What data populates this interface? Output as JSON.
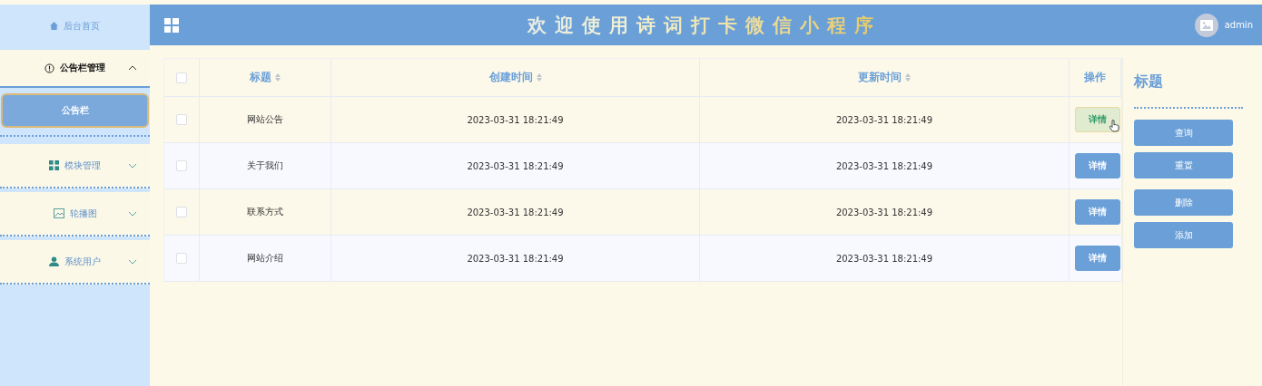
{
  "sidebar": {
    "home": {
      "label": "后台首页"
    },
    "menus": [
      {
        "label": "公告栏管理",
        "kind": "info",
        "expanded": true,
        "children": [
          {
            "label": "公告栏",
            "selected": true
          }
        ]
      },
      {
        "label": "模块管理",
        "kind": "grid",
        "expanded": false
      },
      {
        "label": "轮播图",
        "kind": "image",
        "expanded": false
      },
      {
        "label": "系统用户",
        "kind": "user",
        "expanded": false
      }
    ]
  },
  "header": {
    "title": "欢迎使用诗词打卡微信小程序",
    "user": "admin"
  },
  "table": {
    "all_checked": false,
    "columns": [
      {
        "label": "标题",
        "sortable": true
      },
      {
        "label": "创建时间",
        "sortable": true
      },
      {
        "label": "更新时间",
        "sortable": true
      },
      {
        "label": "操作",
        "sortable": false
      }
    ],
    "rows": [
      {
        "checked": false,
        "title": "网站公告",
        "created": "2023-03-31 18:21:49",
        "updated": "2023-03-31 18:21:49",
        "action": "详情",
        "hovered": true
      },
      {
        "checked": false,
        "title": "关于我们",
        "created": "2023-03-31 18:21:49",
        "updated": "2023-03-31 18:21:49",
        "action": "详情",
        "hovered": false
      },
      {
        "checked": false,
        "title": "联系方式",
        "created": "2023-03-31 18:21:49",
        "updated": "2023-03-31 18:21:49",
        "action": "详情",
        "hovered": false
      },
      {
        "checked": false,
        "title": "网站介绍",
        "created": "2023-03-31 18:21:49",
        "updated": "2023-03-31 18:21:49",
        "action": "详情",
        "hovered": false
      }
    ]
  },
  "panel": {
    "title": "标题",
    "buttons": [
      "查询",
      "重置",
      "删除",
      "添加"
    ]
  }
}
